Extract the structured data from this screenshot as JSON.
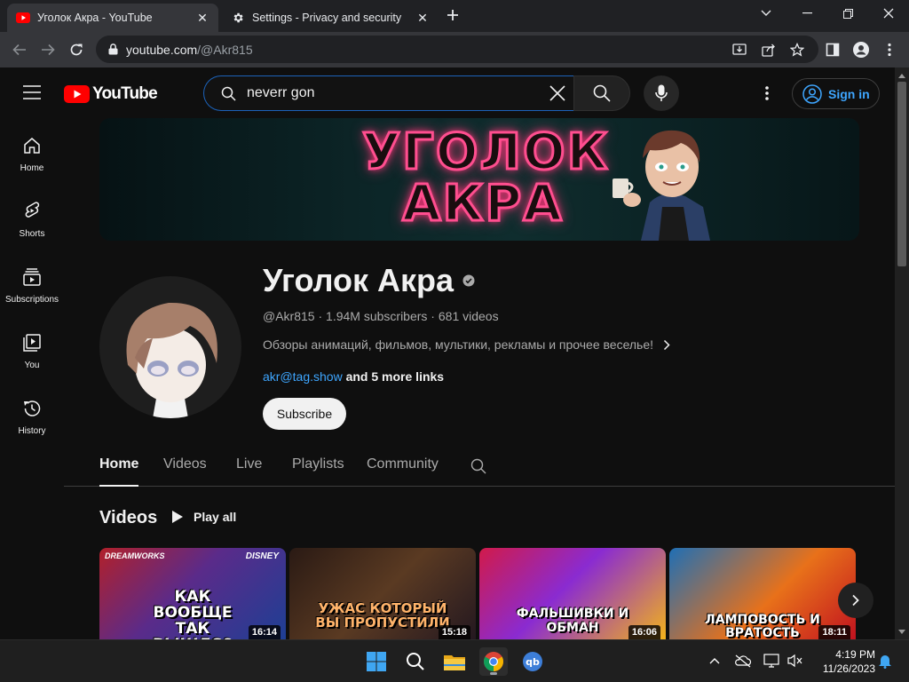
{
  "browser": {
    "tabs": [
      {
        "title": "Уголок Акра - YouTube",
        "active": true
      },
      {
        "title": "Settings - Privacy and security",
        "active": false
      }
    ],
    "url_host": "youtube.com",
    "url_path": "/@Akr815"
  },
  "youtube": {
    "logo_text": "YouTube",
    "search_query": "neverr gon",
    "signin_label": "Sign in",
    "guide": [
      {
        "label": "Home",
        "icon": "home-icon"
      },
      {
        "label": "Shorts",
        "icon": "shorts-icon"
      },
      {
        "label": "Subscriptions",
        "icon": "subscriptions-icon"
      },
      {
        "label": "You",
        "icon": "you-icon"
      },
      {
        "label": "History",
        "icon": "history-icon"
      }
    ],
    "banner_text_line1": "УГОЛОК",
    "banner_text_line2": "АКРА",
    "channel": {
      "name": "Уголок Акра",
      "handle": "@Akr815",
      "subscribers": "1.94M subscribers",
      "videos": "681 videos",
      "description": "Обзоры анимаций, фильмов, мультики, рекламы и прочее веселье!",
      "link": "akr@tag.show",
      "more_links": "and 5 more links",
      "subscribe_label": "Subscribe"
    },
    "tabs": [
      "Home",
      "Videos",
      "Live",
      "Playlists",
      "Community"
    ],
    "section_title": "Videos",
    "play_all_label": "Play all",
    "videos": [
      {
        "thumb_text": "КАК ВООБЩЕ ТАК ВЫШЛО?",
        "duration": "16:14",
        "brand_left": "DREAMWORKS",
        "brand_right": "DISNEY"
      },
      {
        "thumb_text": "УЖАС КОТОРЫЙ ВЫ ПРОПУСТИЛИ",
        "duration": "15:18"
      },
      {
        "thumb_text": "ФАЛЬШИВКИ И ОБМАН",
        "duration": "16:06"
      },
      {
        "thumb_text": "ЛАМПОВОСТЬ И ВРАТОСТЬ",
        "duration": "18:11"
      }
    ]
  },
  "taskbar": {
    "time": "4:19 PM",
    "date": "11/26/2023",
    "apps": [
      "windows-start",
      "search",
      "file-explorer",
      "chrome",
      "qbittorrent"
    ]
  },
  "colors": {
    "accent_blue": "#3ea6ff",
    "youtube_red": "#ff0000",
    "banner_neon": "#ff4e8f"
  }
}
